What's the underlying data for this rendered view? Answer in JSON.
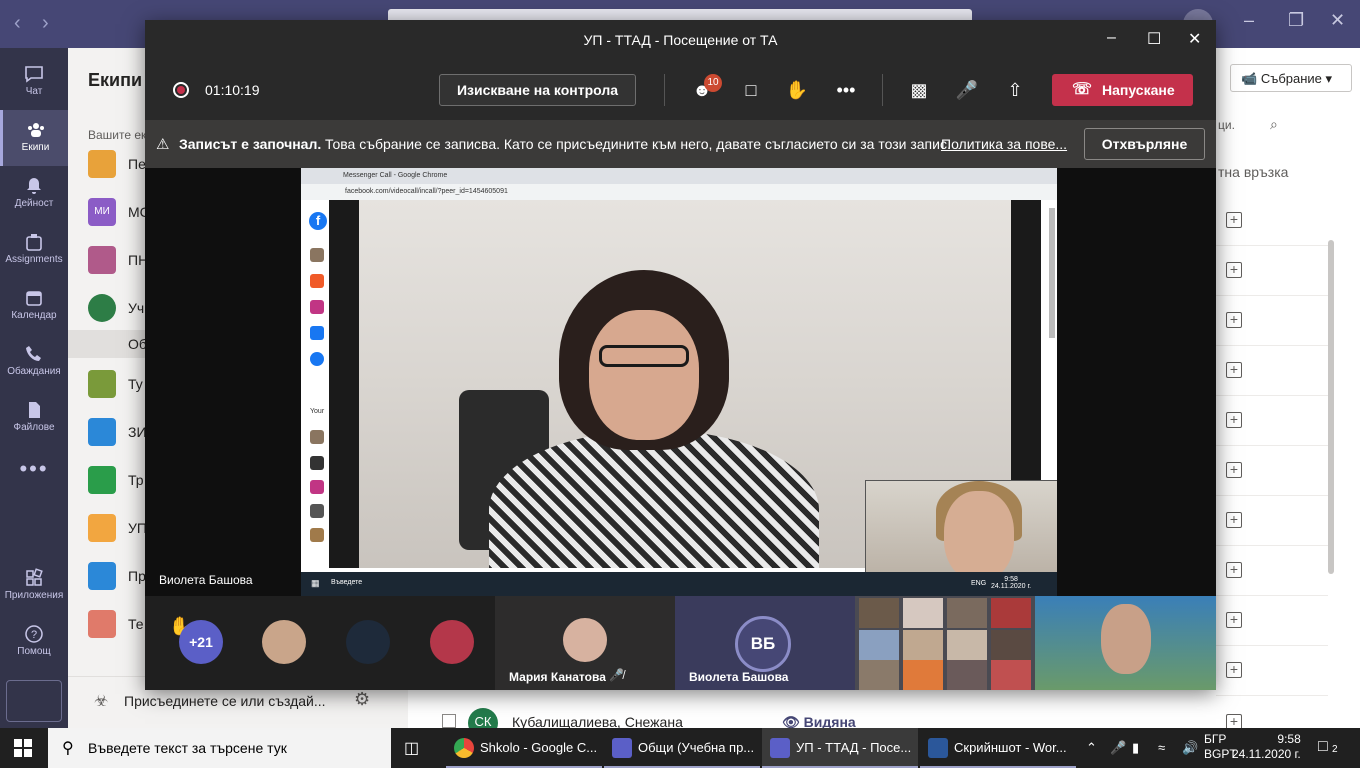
{
  "teams": {
    "rail": [
      {
        "label": "Чат",
        "icon": "chat-icon"
      },
      {
        "label": "Екипи",
        "icon": "teams-icon"
      },
      {
        "label": "Дейност",
        "icon": "bell-icon"
      },
      {
        "label": "Assignments",
        "icon": "assignments-icon"
      },
      {
        "label": "Календар",
        "icon": "calendar-icon"
      },
      {
        "label": "Обаждания",
        "icon": "phone-icon"
      },
      {
        "label": "Файлове",
        "icon": "files-icon"
      },
      {
        "label": "Приложения",
        "icon": "apps-icon"
      },
      {
        "label": "Помощ",
        "icon": "help-icon"
      }
    ],
    "panel_title": "Екипи",
    "panel_subtitle": "Вашите ек",
    "team_items": [
      {
        "label": "Пе",
        "color": "#e8a23a"
      },
      {
        "label": "МС",
        "color": "#8b5cc6",
        "abbr": "МИ"
      },
      {
        "label": "ПН",
        "color": "#e6e6e6"
      },
      {
        "label": "Уч",
        "color": "#2d7d46"
      },
      {
        "label": "Об",
        "selected": true
      },
      {
        "label": "Ту",
        "color": "#7a9a3a"
      },
      {
        "label": "ЗИ",
        "color": "#2b88d8"
      },
      {
        "label": "Тр",
        "color": "#2a9d4a"
      },
      {
        "label": "УП",
        "color": "#f2a640"
      },
      {
        "label": "Пр",
        "color": "#2b88d8"
      },
      {
        "label": "Те",
        "color": "#e07a6a"
      }
    ],
    "join_label": "Присъединете се или създай...",
    "meeting_button": "Събрание",
    "column_header": "тна връзка",
    "search_hint": "ци.",
    "bottom_row": {
      "initials": "СК",
      "name": "Кубалищалиева, Снежана",
      "status": "Видяна"
    }
  },
  "meeting": {
    "title": "УП - ТТАД - Посещение от ТА",
    "timer": "01:10:19",
    "request_control": "Изискване на контрола",
    "participants_badge": "10",
    "leave_label": "Напускане",
    "banner": {
      "bold": "Записът е започнал.",
      "message": "Това събрание се записва. Като се присъедините към него, давате съгласието си за този запис.",
      "link": "Политика за пове...",
      "decline": "Отхвърляне"
    },
    "shared": {
      "window_title": "Messenger Call - Google Chrome",
      "url": "facebook.com/videocall/incall/?peer_id=1454605091",
      "sidebar_text": "Your",
      "taskbar_search": "Въведете",
      "clock_time": "9:58",
      "clock_date": "24.11.2020 г.",
      "lang": "ENG"
    },
    "presenter": "Виолета Башова",
    "roster": {
      "overflow": "+21",
      "tile1_name": "Мария Канатова",
      "tile2_initials": "ВБ",
      "tile2_name": "Виолета Башова"
    }
  },
  "taskbar": {
    "search_placeholder": "Въведете текст за търсене тук",
    "apps": [
      {
        "label": "Shkolo - Google C...",
        "icon": "chrome-icon",
        "color": "#e8453c"
      },
      {
        "label": "Общи (Учебна пр...",
        "icon": "teams-icon",
        "color": "#5b5fc7"
      },
      {
        "label": "УП - ТТАД - Посе...",
        "icon": "teams-icon",
        "color": "#5b5fc7",
        "active": true
      },
      {
        "label": "Скрийншот - Wor...",
        "icon": "word-icon",
        "color": "#2b579a"
      }
    ],
    "lang_top": "БГР",
    "lang_bottom": "BGPT",
    "time": "9:58",
    "date": "24.11.2020 г.",
    "notifications": "2"
  }
}
